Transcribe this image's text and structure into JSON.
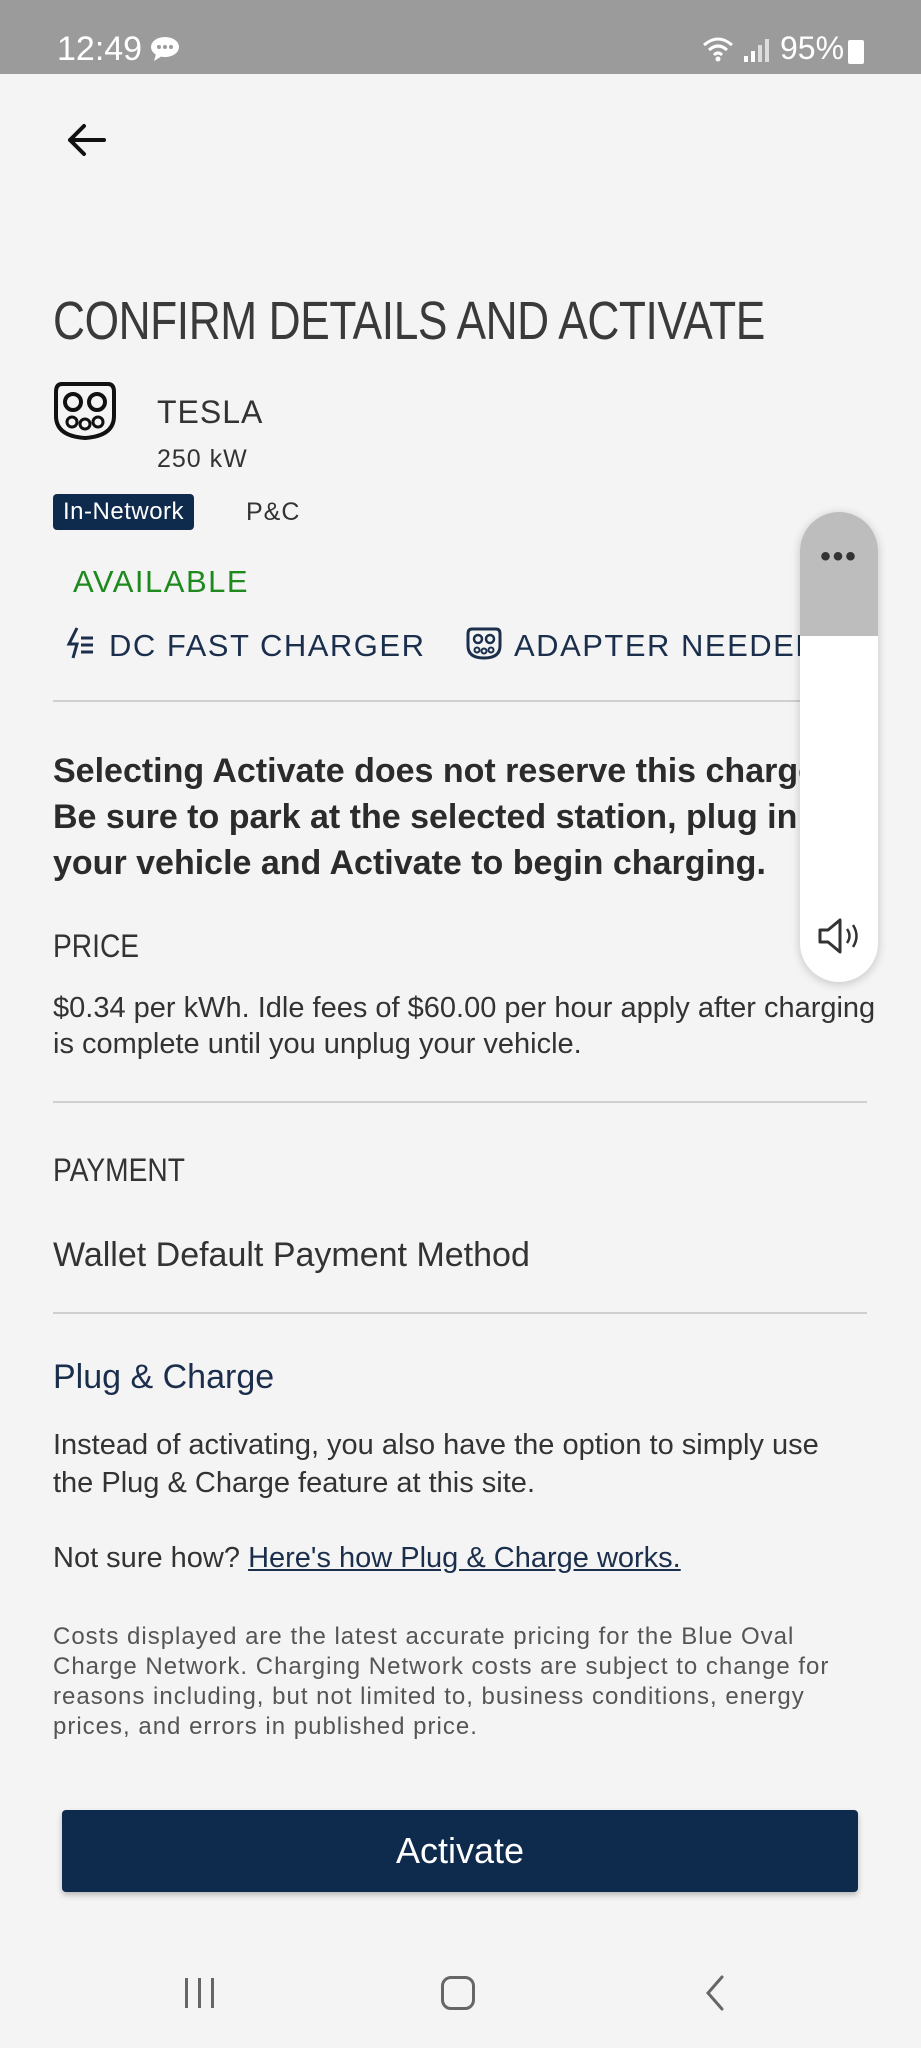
{
  "status_bar": {
    "time": "12:49",
    "battery": "95%"
  },
  "header": {
    "title": "CONFIRM DETAILS AND ACTIVATE"
  },
  "station": {
    "name": "TESLA",
    "power": "250 kW",
    "network_badge": "In-Network",
    "tag": "P&C",
    "availability": "AVAILABLE",
    "availability_color": "#1e8a1e",
    "features": [
      "DC FAST CHARGER",
      "ADAPTER NEEDED"
    ]
  },
  "notice": {
    "lines": [
      "Selecting Activate does not reserve this charger.",
      "Be sure to park at the selected station, plug in",
      "your vehicle and Activate to begin charging."
    ]
  },
  "price": {
    "label": "PRICE",
    "text": "$0.34 per kWh. Idle fees of $60.00 per hour apply after charging is complete until you unplug your vehicle."
  },
  "payment": {
    "label": "PAYMENT",
    "method": "Wallet Default Payment Method"
  },
  "plug_charge": {
    "heading": "Plug & Charge",
    "text": "Instead of activating, you also have the option to simply use the Plug & Charge feature at this site.",
    "help_prefix": "Not sure how?",
    "help_link": "Here's how Plug & Charge works."
  },
  "disclaimer": "Costs displayed are the latest accurate pricing for the Blue Oval Charge Network. Charging Network costs are subject to change for reasons including, but not limited to, business conditions, energy prices, and errors in published price.",
  "actions": {
    "activate_label": "Activate"
  },
  "volume_overlay": {
    "more_icon": "more-icon",
    "level": 0.26
  },
  "colors": {
    "brand_navy": "#0e2a4d",
    "status_bar": "#9b9b9b"
  }
}
